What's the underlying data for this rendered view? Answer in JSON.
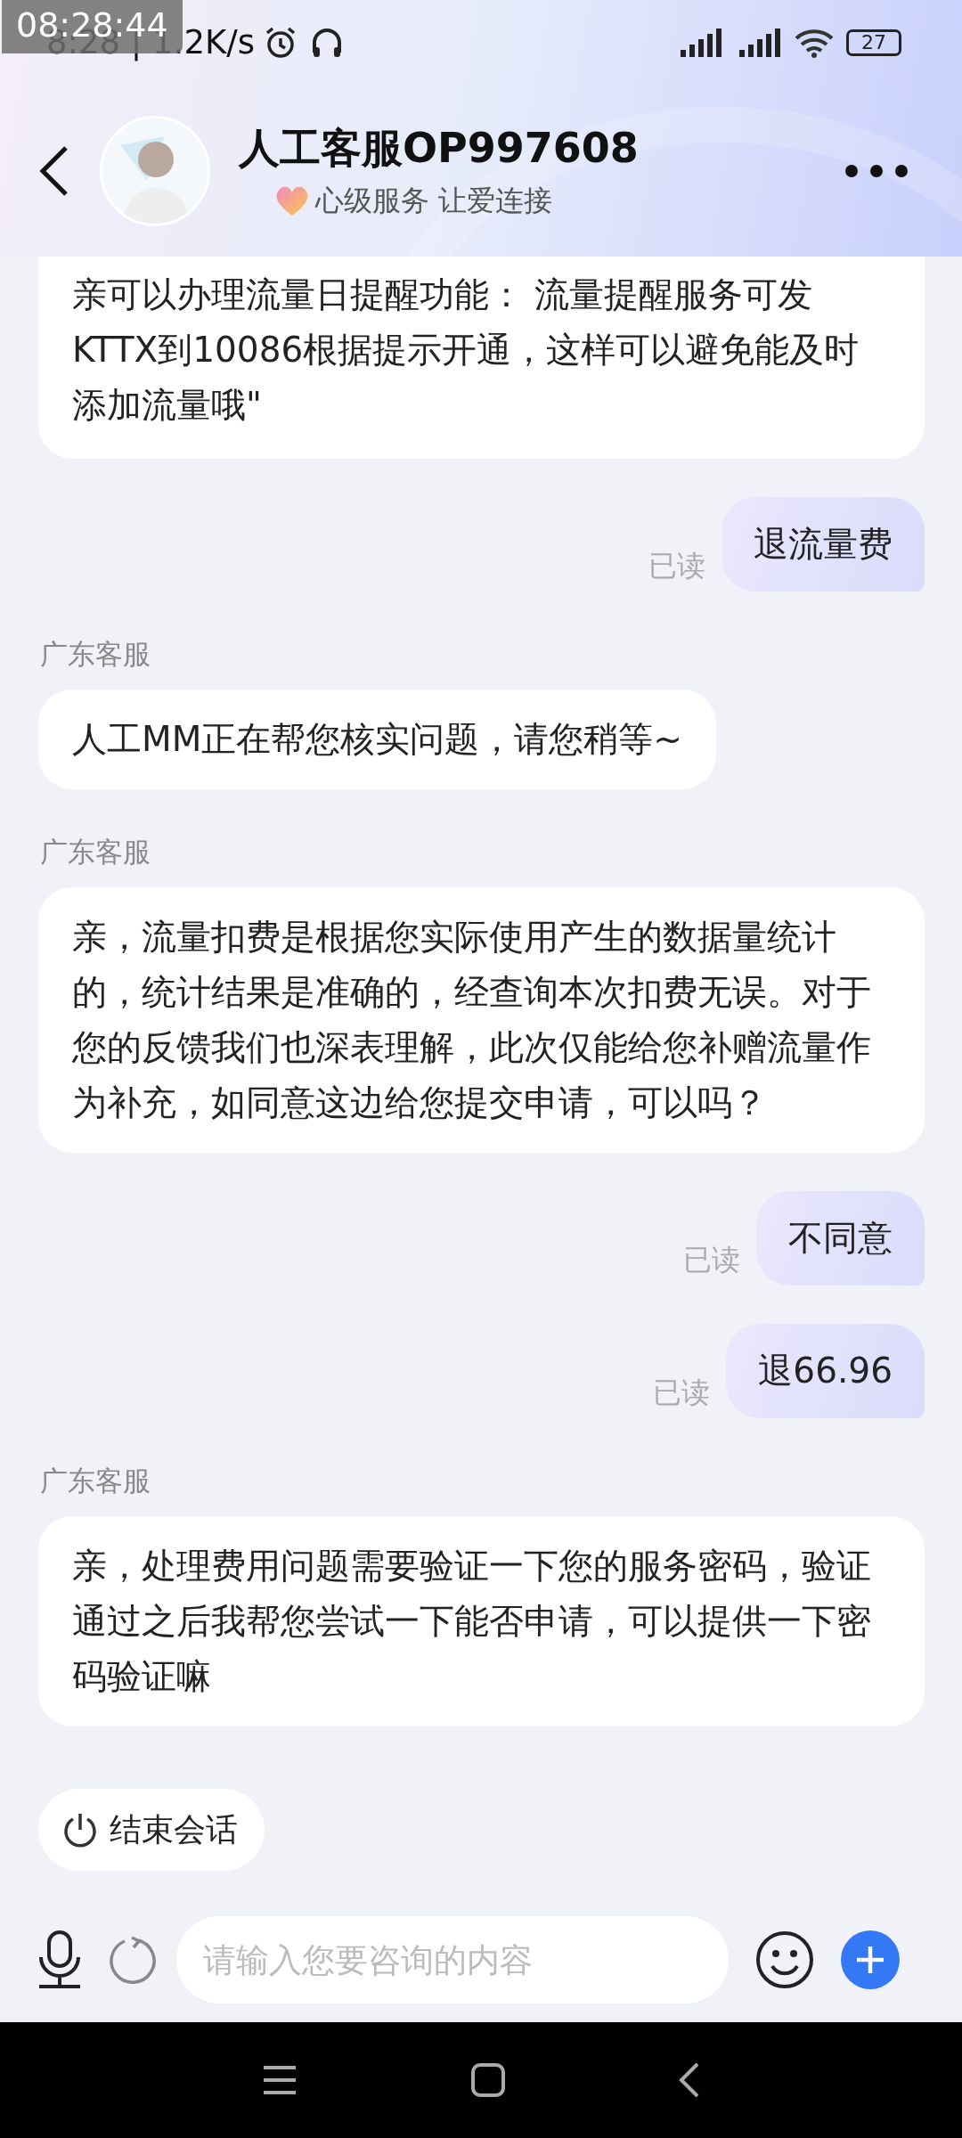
{
  "clock_overlay": "08:28:44",
  "status_bar": {
    "time": "8:28 | 1.2K/s",
    "battery": "27"
  },
  "header": {
    "title": "人工客服OP997608",
    "subtitle": "心级服务 让爱连接"
  },
  "messages": [
    {
      "kind": "agent",
      "text": "亲可以办理流量日提醒功能： 流量提醒服务可发KTTX到10086根据提示开通，这样可以避免能及时添加流量哦\"",
      "cut_top": true
    },
    {
      "kind": "user",
      "text": "退流量费",
      "receipt": "已读"
    },
    {
      "kind": "agent",
      "sender": "广东客服",
      "text": "人工MM正在帮您核实问题，请您稍等~"
    },
    {
      "kind": "agent",
      "sender": "广东客服",
      "text": "亲，流量扣费是根据您实际使用产生的数据量统计的，统计结果是准确的，经查询本次扣费无误。对于您的反馈我们也深表理解，此次仅能给您补赠流量作为补充，如同意这边给您提交申请，可以吗？"
    },
    {
      "kind": "user",
      "text": "不同意",
      "receipt": "已读"
    },
    {
      "kind": "user",
      "text": "退66.96",
      "receipt": "已读"
    },
    {
      "kind": "agent",
      "sender": "广东客服",
      "text": "亲，处理费用问题需要验证一下您的服务密码，验证通过之后我帮您尝试一下能否申请，可以提供一下密码验证嘛"
    }
  ],
  "end_chat_button": "结束会话",
  "input": {
    "placeholder": "请输入您要咨询的内容"
  }
}
